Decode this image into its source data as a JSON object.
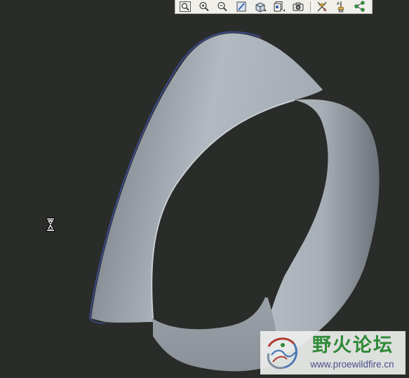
{
  "window": {
    "title": ""
  },
  "toolbar": {
    "buttons": [
      {
        "icon": "zoom-fit-icon"
      },
      {
        "icon": "zoom-in-icon"
      },
      {
        "icon": "zoom-out-icon"
      },
      {
        "icon": "repaint-icon"
      },
      {
        "icon": "display-style-icon"
      },
      {
        "icon": "saved-views-icon"
      },
      {
        "icon": "spin-center-icon"
      },
      {
        "icon": "datum-planes-icon"
      },
      {
        "icon": "datum-axes-icon"
      },
      {
        "icon": "datum-points-icon"
      }
    ]
  },
  "viewport": {
    "background": "#2a2c29",
    "model": {
      "name": "",
      "surface_color": "#9aa2ab",
      "edge_highlight": "#3b4a8c"
    }
  },
  "cursor": {
    "state": "busy",
    "icon": "hourglass-icon"
  },
  "watermark": {
    "title": "野火论坛",
    "url": "www.proewildfire.cn",
    "title_color": "#2f8a36",
    "url_color": "#4a4f88"
  }
}
